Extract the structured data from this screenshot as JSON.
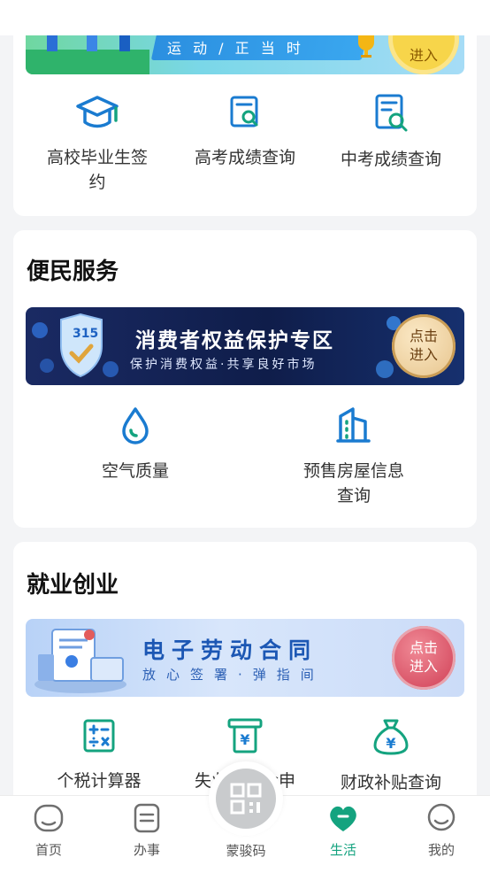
{
  "top_banner": {
    "text": "运 动 / 正 当 时",
    "enter": "进入"
  },
  "education": {
    "items": [
      {
        "label": "高校毕业生签约",
        "icon": "graduation-cap-icon"
      },
      {
        "label": "高考成绩查询",
        "icon": "doc-search-icon"
      },
      {
        "label": "中考成绩查询",
        "icon": "doc-search-cap-icon"
      }
    ]
  },
  "convenience": {
    "title": "便民服务",
    "banner": {
      "badge": "315",
      "title": "消费者权益保护专区",
      "subtitle": "保护消费权益·共享良好市场",
      "button": "点击\n进入"
    },
    "items": [
      {
        "label": "空气质量",
        "icon": "water-drop-icon"
      },
      {
        "label": "预售房屋信息查询",
        "icon": "building-icon"
      }
    ]
  },
  "employment": {
    "title": "就业创业",
    "banner": {
      "title": "电子劳动合同",
      "subtitle": "放心签署·弹指间",
      "button": "点击\n进入"
    },
    "items": [
      {
        "label": "个税计算器",
        "icon": "calculator-icon"
      },
      {
        "label": "失业保险金申",
        "icon": "yuan-atm-icon"
      },
      {
        "label": "财政补贴查询",
        "icon": "money-bag-icon"
      }
    ]
  },
  "tabbar": {
    "items": [
      {
        "label": "首页",
        "icon": "home-icon"
      },
      {
        "label": "办事",
        "icon": "tasks-icon"
      },
      {
        "label": "蒙骏码",
        "icon": "qr-code-icon"
      },
      {
        "label": "生活",
        "icon": "life-icon"
      },
      {
        "label": "我的",
        "icon": "profile-icon"
      }
    ],
    "active": "生活"
  },
  "colors": {
    "accent": "#14a37f",
    "icon_blue": "#1a7bd0",
    "banner_dark": "#0f1d4a",
    "banner_light": "#cfe0fb"
  }
}
